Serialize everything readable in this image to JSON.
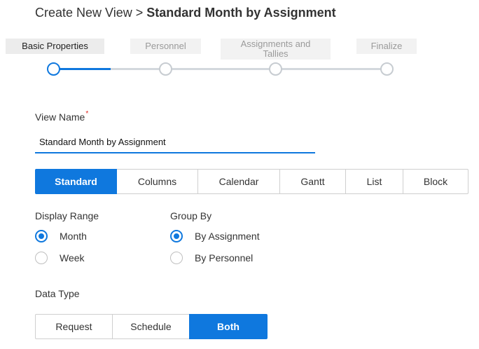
{
  "header": {
    "prefix": "Create New View > ",
    "view_title": "Standard Month by Assignment"
  },
  "wizard": {
    "steps": [
      {
        "label": "Basic Properties",
        "state": "active"
      },
      {
        "label": "Personnel",
        "state": "inactive"
      },
      {
        "label": "Assignments and Tallies",
        "state": "inactive"
      },
      {
        "label": "Finalize",
        "state": "inactive"
      }
    ],
    "progress_fraction": 0.17
  },
  "view_name": {
    "label": "View Name",
    "required_mark": "*",
    "value": "Standard Month by Assignment"
  },
  "view_type": {
    "options": [
      "Standard",
      "Columns",
      "Calendar",
      "Gantt",
      "List",
      "Block"
    ],
    "selected": "Standard"
  },
  "display_range": {
    "label": "Display Range",
    "options": [
      "Month",
      "Week"
    ],
    "selected": "Month"
  },
  "group_by": {
    "label": "Group By",
    "options": [
      "By Assignment",
      "By Personnel"
    ],
    "selected": "By Assignment"
  },
  "data_type": {
    "label": "Data Type",
    "options": [
      "Request",
      "Schedule",
      "Both"
    ],
    "selected": "Both"
  },
  "colors": {
    "accent": "#0f78de",
    "required": "#e0241d"
  }
}
